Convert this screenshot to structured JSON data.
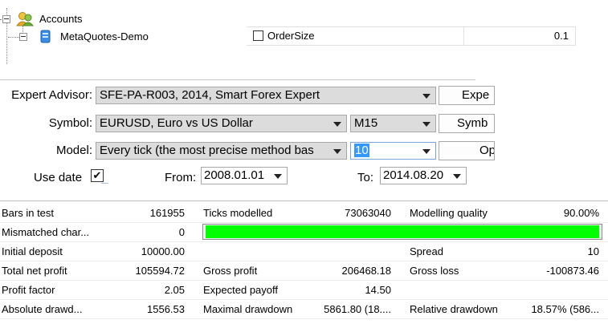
{
  "tree": {
    "root_label": "Accounts",
    "child_label": "MetaQuotes-Demo"
  },
  "inputs_panel": {
    "rows": [
      {
        "name": "OrderSize",
        "value": "0.1"
      }
    ]
  },
  "settings": {
    "expert_label": "Expert Advisor:",
    "expert_value": "SFE-PA-R003, 2014, Smart Forex Expert",
    "expert_button": "Expe",
    "symbol_label": "Symbol:",
    "symbol_value": "EURUSD, Euro vs US Dollar",
    "period_value": "M15",
    "symbol_button": "Symb",
    "model_label": "Model:",
    "model_value": "Every tick (the most precise method bas",
    "spread_value": "10",
    "model_button": "Op",
    "use_date_label": "Use date",
    "use_date_check": "✔",
    "from_label": "From:",
    "from_value": "2008.01.01",
    "to_label": "To:",
    "to_value": "2014.08.20"
  },
  "results": {
    "bars_in_test_label": "Bars in test",
    "bars_in_test_value": "161955",
    "ticks_modelled_label": "Ticks modelled",
    "ticks_modelled_value": "73063040",
    "modelling_quality_label": "Modelling quality",
    "modelling_quality_value": "90.00%",
    "mismatched_label": "Mismatched char...",
    "mismatched_value": "0",
    "quality_fill_fraction": 1.0,
    "quality_bar_color": "#00ff00",
    "initial_deposit_label": "Initial deposit",
    "initial_deposit_value": "10000.00",
    "spread_label": "Spread",
    "spread_value": "10",
    "total_net_profit_label": "Total net profit",
    "total_net_profit_value": "105594.72",
    "gross_profit_label": "Gross profit",
    "gross_profit_value": "206468.18",
    "gross_loss_label": "Gross loss",
    "gross_loss_value": "-100873.46",
    "profit_factor_label": "Profit factor",
    "profit_factor_value": "2.05",
    "expected_payoff_label": "Expected payoff",
    "expected_payoff_value": "14.50",
    "absolute_drawdown_label": "Absolute drawd...",
    "absolute_drawdown_value": "1556.53",
    "maximal_drawdown_label": "Maximal drawdown",
    "maximal_drawdown_value": "5861.80 (18....",
    "relative_drawdown_label": "Relative drawdown",
    "relative_drawdown_value": "18.57% (586..."
  }
}
